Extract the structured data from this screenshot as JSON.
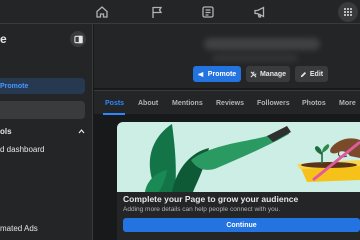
{
  "topbar": {
    "icons": [
      "home-icon",
      "flag-icon",
      "pages-feed-icon",
      "megaphone-icon",
      "menu-grid-icon"
    ]
  },
  "sidebar": {
    "title": "e",
    "promote_label": "Promote",
    "tools_heading": "ols",
    "dashboard_label": "d dashboard",
    "ads_label": "mated Ads"
  },
  "page_header": {
    "promote_label": "Promote",
    "manage_label": "Manage",
    "edit_label": "Edit"
  },
  "tabs": [
    {
      "label": "Posts",
      "active": true
    },
    {
      "label": "About",
      "active": false
    },
    {
      "label": "Mentions",
      "active": false
    },
    {
      "label": "Reviews",
      "active": false
    },
    {
      "label": "Followers",
      "active": false
    },
    {
      "label": "Photos",
      "active": false
    },
    {
      "label": "More",
      "active": false
    }
  ],
  "card": {
    "title": "Complete your Page to grow your audience",
    "subtitle": "Adding more details can help people connect with you.",
    "button_label": "Continue"
  },
  "colors": {
    "accent": "#2374e1",
    "active_tab": "#2d88ff",
    "surface": "#242526",
    "background": "#18191a"
  }
}
